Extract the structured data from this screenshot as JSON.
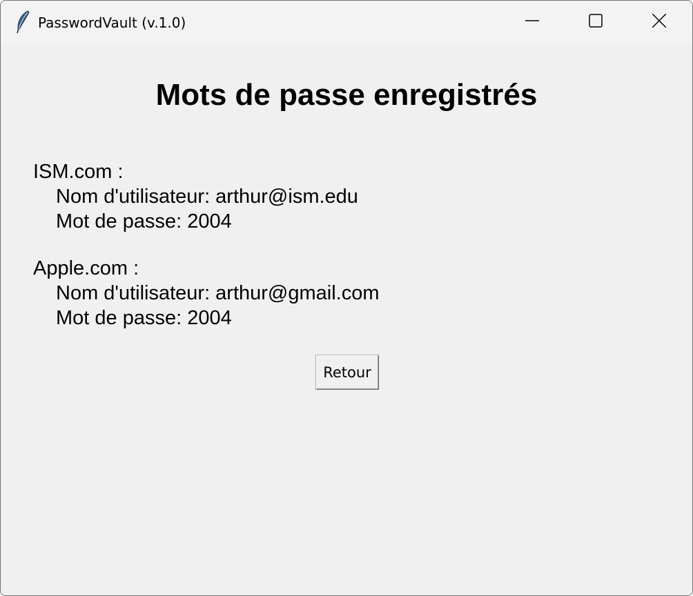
{
  "window": {
    "title": "PasswordVault (v.1.0)",
    "icon": "feather-icon",
    "controls": [
      "minimize-icon",
      "maximize-icon",
      "close-icon"
    ]
  },
  "main": {
    "heading": "Mots de passe enregistrés",
    "entries": [
      {
        "site": "ISM.com :",
        "username": "Nom d'utilisateur: arthur@ism.edu",
        "password": "Mot de passe: 2004"
      },
      {
        "site": "Apple.com :",
        "username": "Nom d'utilisateur: arthur@gmail.com",
        "password": "Mot de passe: 2004"
      }
    ],
    "back_label": "Retour"
  }
}
